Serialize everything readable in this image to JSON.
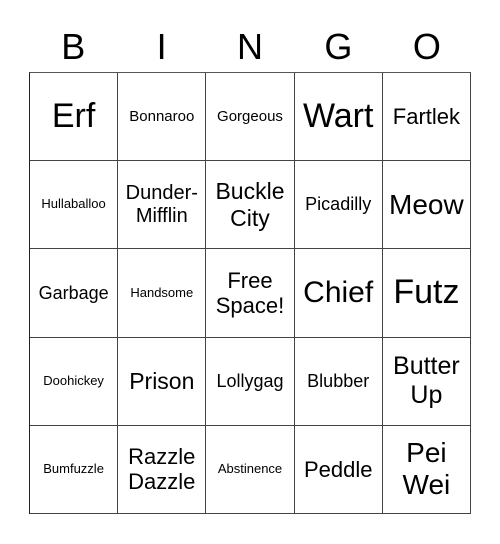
{
  "header": {
    "letters": [
      "B",
      "I",
      "N",
      "G",
      "O"
    ]
  },
  "cells": [
    [
      "Erf",
      "Bonnaroo",
      "Gorgeous",
      "Wart",
      "Fartlek"
    ],
    [
      "Hullaballoo",
      "Dunder-\nMifflin",
      "Buckle\nCity",
      "Picadilly",
      "Meow"
    ],
    [
      "Garbage",
      "Handsome",
      "Free\nSpace!",
      "Chief",
      "Futz"
    ],
    [
      "Doohickey",
      "Prison",
      "Lollygag",
      "Blubber",
      "Butter\nUp"
    ],
    [
      "Bumfuzzle",
      "Razzle\nDazzle",
      "Abstinence",
      "Peddle",
      "Pei\nWei"
    ]
  ]
}
